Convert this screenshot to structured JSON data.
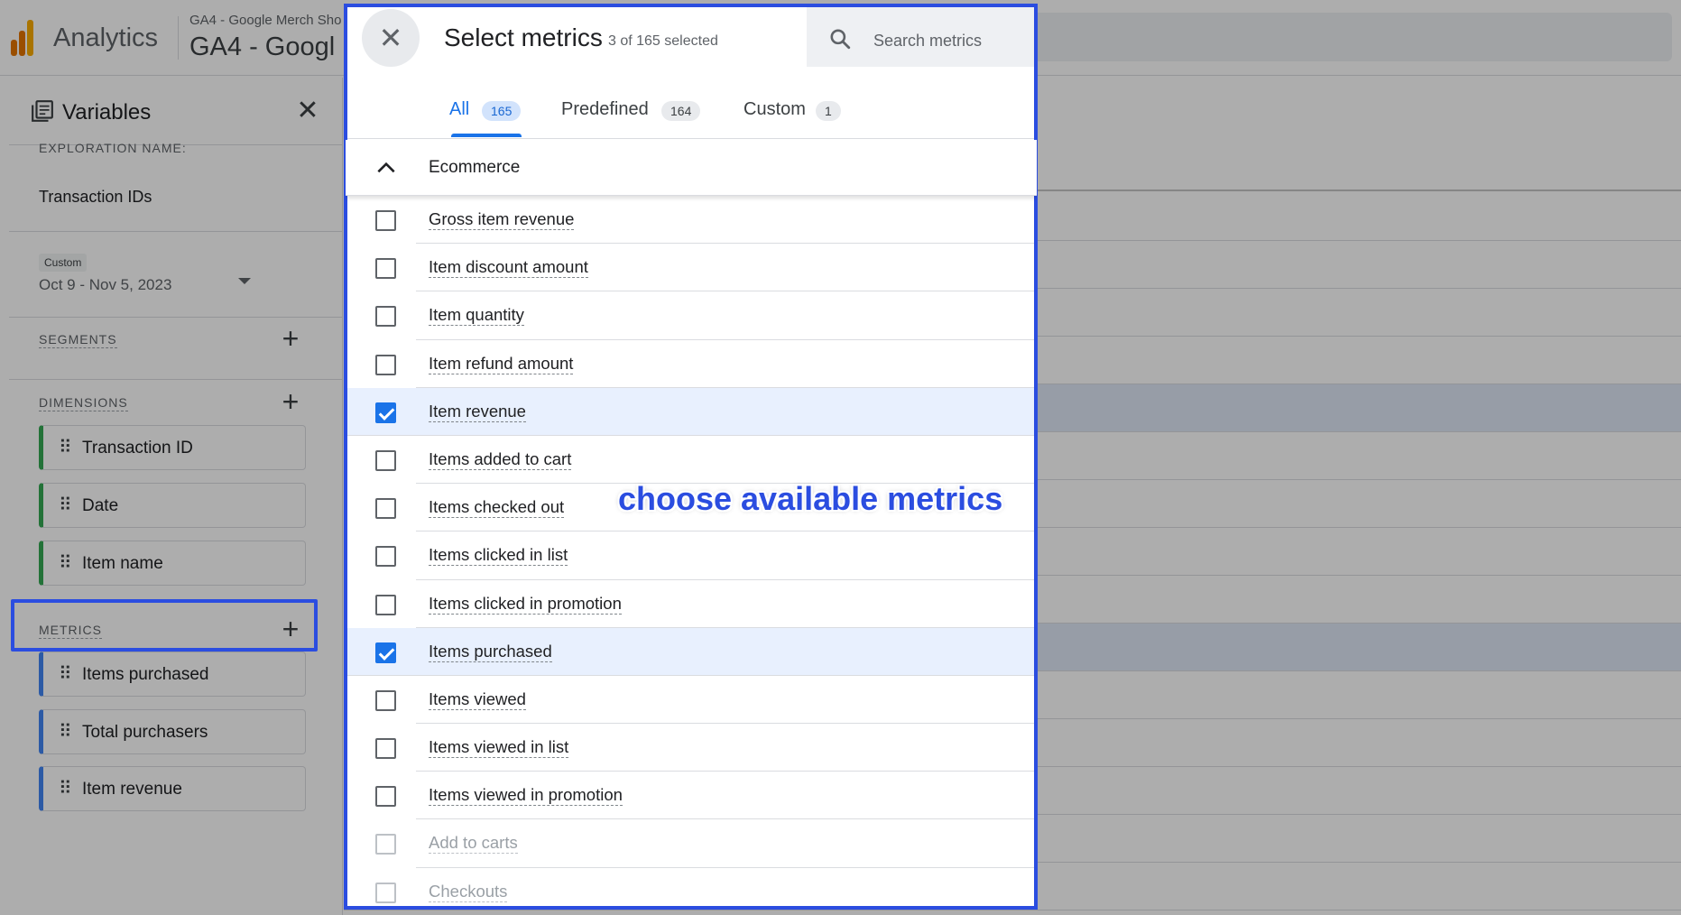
{
  "app": {
    "name": "Analytics",
    "property_sub": "GA4 - Google Merch Sho",
    "property_main": "GA4 - Googl"
  },
  "variables_panel": {
    "title": "Variables",
    "exploration_name_label": "EXPLORATION NAME:",
    "exploration_name": "Transaction IDs",
    "date_chip": "Custom",
    "date_range": "Oct 9 - Nov 5, 2023",
    "segments_label": "SEGMENTS",
    "dimensions_label": "DIMENSIONS",
    "dimensions": [
      "Transaction ID",
      "Date",
      "Item name"
    ],
    "metrics_label": "METRICS",
    "metrics": [
      "Items purchased",
      "Total purchasers",
      "Item revenue"
    ]
  },
  "dialog": {
    "title": "Select metrics",
    "selected_count": "3 of 165 selected",
    "search_placeholder": "Search metrics",
    "tabs": [
      {
        "label": "All",
        "count": "165",
        "active": true
      },
      {
        "label": "Predefined",
        "count": "164",
        "active": false
      },
      {
        "label": "Custom",
        "count": "1",
        "active": false
      }
    ],
    "group": "Ecommerce",
    "metrics": [
      {
        "label": "Gross item revenue",
        "checked": false,
        "disabled": false
      },
      {
        "label": "Item discount amount",
        "checked": false,
        "disabled": false
      },
      {
        "label": "Item quantity",
        "checked": false,
        "disabled": false
      },
      {
        "label": "Item refund amount",
        "checked": false,
        "disabled": false
      },
      {
        "label": "Item revenue",
        "checked": true,
        "disabled": false
      },
      {
        "label": "Items added to cart",
        "checked": false,
        "disabled": false
      },
      {
        "label": "Items checked out",
        "checked": false,
        "disabled": false
      },
      {
        "label": "Items clicked in list",
        "checked": false,
        "disabled": false
      },
      {
        "label": "Items clicked in promotion",
        "checked": false,
        "disabled": false
      },
      {
        "label": "Items purchased",
        "checked": true,
        "disabled": false
      },
      {
        "label": "Items viewed",
        "checked": false,
        "disabled": false
      },
      {
        "label": "Items viewed in list",
        "checked": false,
        "disabled": false
      },
      {
        "label": "Items viewed in promotion",
        "checked": false,
        "disabled": false
      },
      {
        "label": "Add to carts",
        "checked": false,
        "disabled": true
      },
      {
        "label": "Checkouts",
        "checked": false,
        "disabled": true
      }
    ]
  },
  "annotation": "choose available metrics",
  "colors": {
    "accent": "#1a73e8",
    "highlight_frame": "#2b4de0",
    "selected_row": "#e8f0fe",
    "dimension_chip": "#34a853",
    "metric_chip": "#4285f4"
  },
  "icons": {
    "dialog_close": "close-icon",
    "panel_close": "close-icon",
    "search": "search-icon",
    "group_toggle": "chevron-up-icon",
    "variables": "variables-icon",
    "chip_handle": "drag-handle-icon",
    "add": "plus-icon"
  }
}
